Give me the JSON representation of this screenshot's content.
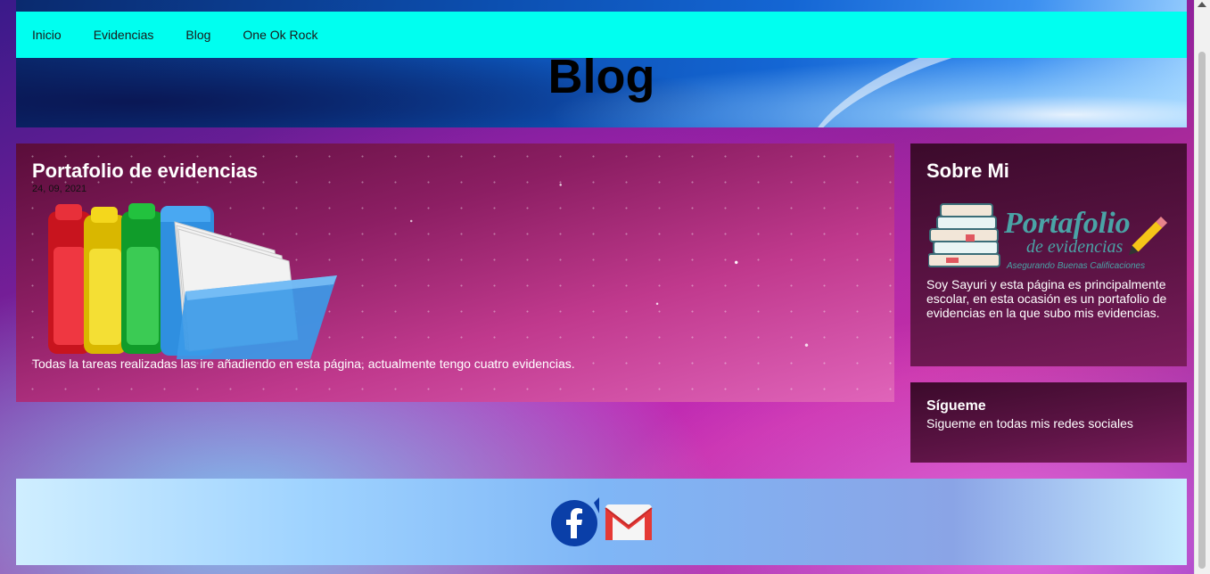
{
  "nav": {
    "items": [
      {
        "label": "Inicio"
      },
      {
        "label": "Evidencias"
      },
      {
        "label": "Blog"
      },
      {
        "label": "One Ok Rock"
      }
    ]
  },
  "hero": {
    "title": "Blog"
  },
  "post": {
    "title": "Portafolio de evidencias",
    "date": "24, 09, 2021",
    "image_icon": "colored-folders-icon",
    "text": "Todas la tareas realizadas las ire añadiendo en esta página, actualmente tengo cuatro evidencias."
  },
  "about": {
    "title": "Sobre Mi",
    "logo": {
      "title": "Portafolio",
      "subtitle": "de evidencias",
      "tagline": "Asegurando Buenas Calificaciones"
    },
    "text": "Soy Sayuri y esta página es principalmente escolar, en esta ocasión es un portafolio de evidencias en la que subo mis evidencias."
  },
  "follow": {
    "title": "Sígueme",
    "text": "Sigueme en todas mis redes sociales"
  },
  "footer": {
    "social": [
      {
        "icon": "facebook-icon"
      },
      {
        "icon": "gmail-icon"
      }
    ]
  },
  "colors": {
    "nav_bg": "#00fff0",
    "post_bg": "#c0398d",
    "widget_bg": "#5e1446",
    "facebook": "#0a3fa8",
    "gmail_red": "#e53935"
  }
}
